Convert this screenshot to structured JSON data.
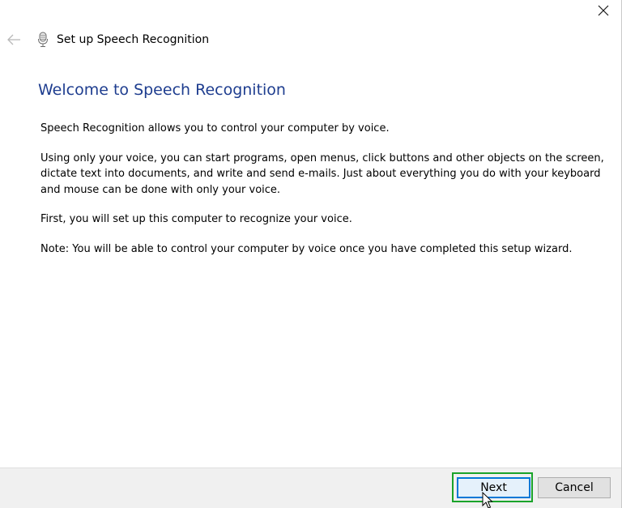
{
  "window": {
    "title": "Set up Speech Recognition",
    "close_icon": "close-icon",
    "back_icon": "back-arrow-icon",
    "app_icon": "microphone-icon"
  },
  "page": {
    "heading": "Welcome to Speech Recognition",
    "paragraphs": [
      "Speech Recognition allows you to control your computer by voice.",
      "Using only your voice, you can start programs, open menus, click buttons and other objects on the screen, dictate text into documents, and write and send e-mails. Just about everything you do with your keyboard and mouse can be done with only your voice.",
      "First, you will set up this computer to recognize your voice.",
      "Note: You will be able to control your computer by voice once you have completed this setup wizard."
    ]
  },
  "footer": {
    "next_label": "Next",
    "cancel_label": "Cancel"
  },
  "colors": {
    "heading": "#1e3d8f",
    "highlight": "#1aa32a",
    "focus_border": "#0078d7"
  }
}
